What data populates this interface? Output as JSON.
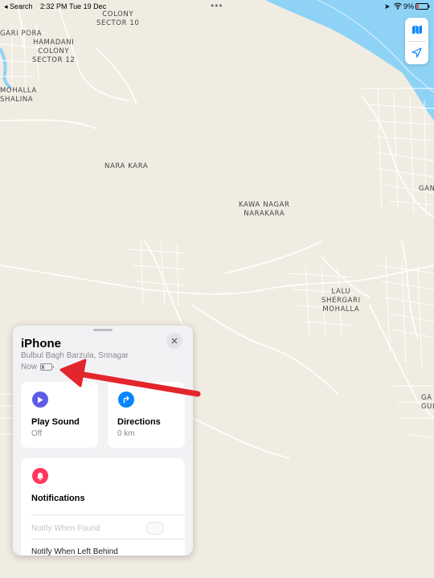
{
  "status_bar": {
    "back_label": "◂ Search",
    "time": "2:32 PM",
    "date": "Tue 19 Dec",
    "battery": "9%"
  },
  "map": {
    "labels": {
      "colony_sector_10": "COLONY\nSECTOR 10",
      "sagari_pora": "GARI PORA",
      "hamadani": "HAMADANI\nCOLONY\nSECTOR 12",
      "mohalla_shalina": "MOHALLA\nSHALINA",
      "nara_kara": "NARA KARA",
      "kawa_nagar": "KAWA NAGAR\nNARAKARA",
      "lalu_shergari": "LALU\nSHERGARI\nMOHALLA",
      "gan": "GAN",
      "ga_gul": "GA\nGUL"
    }
  },
  "panel": {
    "device_name": "iPhone",
    "address": "Bulbul Bagh Barzula, Srinagar",
    "last_seen": "Now",
    "play_sound": {
      "title": "Play Sound",
      "status": "Off"
    },
    "directions": {
      "title": "Directions",
      "distance": "0 km"
    },
    "notifications": {
      "title": "Notifications",
      "notify_when_found": "Notify When Found",
      "notify_when_left_behind": "Notify When Left Behind"
    }
  },
  "colors": {
    "map_land": "#f1ece2",
    "map_water": "#8ed3f5",
    "road": "#ffffff",
    "play_sound_icon": "#5e5ce6",
    "directions_icon": "#0a84ff",
    "notifications_icon": "#ff375f",
    "annotation_arrow": "#e3262b"
  },
  "icons": {
    "map_mode": "map-icon",
    "location": "location-arrow-icon",
    "close": "close-icon",
    "play": "play-icon",
    "directions": "directions-arrow-icon",
    "bell": "bell-icon"
  }
}
